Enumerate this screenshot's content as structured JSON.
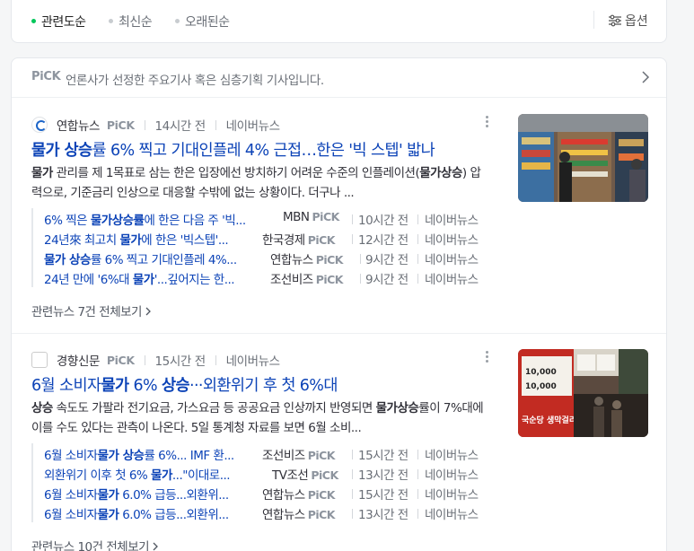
{
  "sort": {
    "items": [
      {
        "label": "관련도순",
        "active": true
      },
      {
        "label": "최신순",
        "active": false
      },
      {
        "label": "오래된순",
        "active": false
      }
    ],
    "option_label": "옵션"
  },
  "pick_header": {
    "logo": "PiCK",
    "text": "언론사가 선정한 주요기사 혹은 심층기획 기사입니다."
  },
  "articles": [
    {
      "press": "연합뉴스",
      "pick": "PiCK",
      "time": "14시간 전",
      "source": "네이버뉴스",
      "title_bold": "물가 상승",
      "title_rest": "률 6% 찍고 기대인플레 4% 근접…한은 '빅 스텝' 밟나",
      "desc_bold1": "물가",
      "desc_part1": " 관리를 제 1목표로 삼는 한은 입장에선 방치하기 어려운 수준의 인플레이션(",
      "desc_bold2": "물가상승",
      "desc_part2": ") 압력으로, 기준금리 인상으로 대응할 수밖에 없는 상황이다. 더구나 ...",
      "related": [
        {
          "pre": "6% 찍은 ",
          "bold": "물가상승률",
          "post": "에 한은 다음 주 '빅...",
          "press": "MBN",
          "pick": "PiCK",
          "time": "10시간 전",
          "source": "네이버뉴스"
        },
        {
          "pre": "24년來 최고치 ",
          "bold": "물가",
          "post": "에 한은 '빅스텝'...",
          "press": "한국경제",
          "pick": "PiCK",
          "time": "12시간 전",
          "source": "네이버뉴스"
        },
        {
          "pre": "",
          "bold": "물가 상승",
          "post": "률 6% 찍고 기대인플레 4%...",
          "press": "연합뉴스",
          "pick": "PiCK",
          "time": "9시간 전",
          "source": "네이버뉴스"
        },
        {
          "pre": "24년 만에 '6%대 ",
          "bold": "물가",
          "post": "'...깊어지는 한...",
          "press": "조선비즈",
          "pick": "PiCK",
          "time": "9시간 전",
          "source": "네이버뉴스"
        }
      ],
      "more_label": "관련뉴스 7건 전체보기"
    },
    {
      "press": "경향신문",
      "pick": "PiCK",
      "time": "15시간 전",
      "source": "네이버뉴스",
      "title_pre": "6월 소비자",
      "title_bold": "물가",
      "title_mid": " 6% ",
      "title_bold2": "상승",
      "title_rest": "···외환위기 후 첫 6%대",
      "desc_bold1": "상승",
      "desc_part1": " 속도도 가팔라 전기요금, 가스요금 등 공공요금 인상까지 반영되면 ",
      "desc_bold2": "물가상승",
      "desc_part2": "률이 7%대에 이를 수도 있다는 관측이 나온다. 5일 통계청 자료를 보면 6월 소비...",
      "related": [
        {
          "pre": "6월 소비자",
          "bold": "물가 상승",
          "post": "률 6%... IMF 환...",
          "press": "조선비즈",
          "pick": "PiCK",
          "time": "15시간 전",
          "source": "네이버뉴스"
        },
        {
          "pre": "외환위기 이후 첫 6% ",
          "bold": "물가",
          "post": "...\"이대로...",
          "press": "TV조선",
          "pick": "PiCK",
          "time": "13시간 전",
          "source": "네이버뉴스"
        },
        {
          "pre": "6월 소비자",
          "bold": "물가",
          "post": " 6.0% 급등...외환위...",
          "press": "연합뉴스",
          "pick": "PiCK",
          "time": "15시간 전",
          "source": "네이버뉴스"
        },
        {
          "pre": "6월 소비자",
          "bold": "물가",
          "post": " 6.0% 급등...외환위...",
          "press": "연합뉴스",
          "pick": "PiCK",
          "time": "13시간 전",
          "source": "네이버뉴스"
        }
      ],
      "more_label": "관련뉴스 10건 전체보기",
      "thumb_sign": [
        "10,000",
        "10,000",
        "국순당 생막걸리"
      ]
    }
  ],
  "colors": {
    "accent": "#03c75a",
    "link": "#0c43b7"
  }
}
